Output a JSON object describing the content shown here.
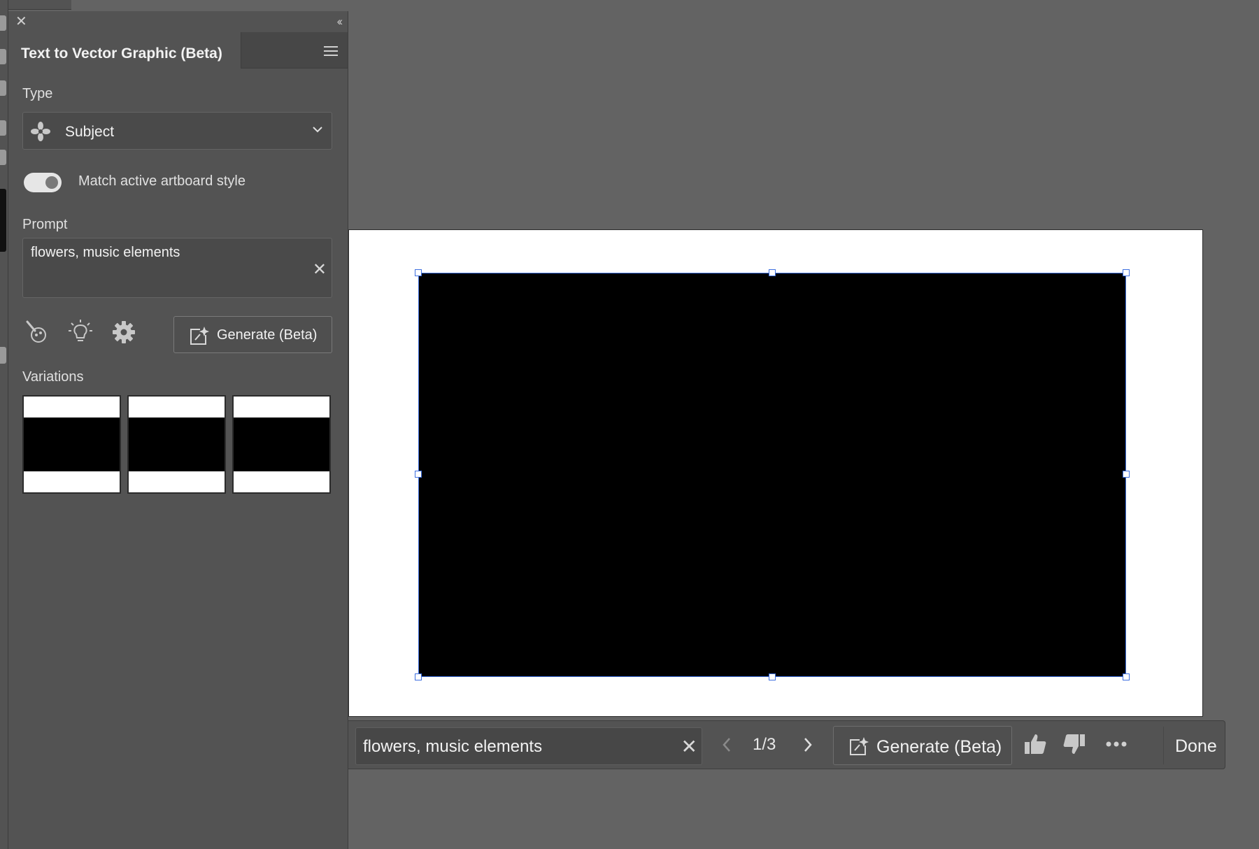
{
  "panel": {
    "title": "Text to Vector Graphic (Beta)",
    "type_label": "Type",
    "type_value": "Subject",
    "match_style_label": "Match active artboard style",
    "match_style_on": true,
    "prompt_label": "Prompt",
    "prompt_value": "flowers, music elements",
    "generate_label": "Generate (Beta)",
    "variations_label": "Variations",
    "variations_count": 3
  },
  "contextual_bar": {
    "prompt_value": "flowers, music elements",
    "counter": "1/3",
    "generate_label": "Generate (Beta)",
    "done_label": "Done"
  },
  "icons": [
    "close-icon",
    "collapse-icon",
    "panel-menu-icon",
    "subject-icon",
    "chevron-down-icon",
    "clear-icon",
    "style-picker-icon",
    "lightbulb-icon",
    "gear-icon",
    "generate-sparkle-icon",
    "chevron-left-icon",
    "chevron-right-icon",
    "thumbs-up-icon",
    "thumbs-down-icon",
    "more-icon"
  ],
  "colors": {
    "panel_bg": "#535353",
    "canvas_bg": "#636363",
    "selection": "#3d6fe0"
  }
}
